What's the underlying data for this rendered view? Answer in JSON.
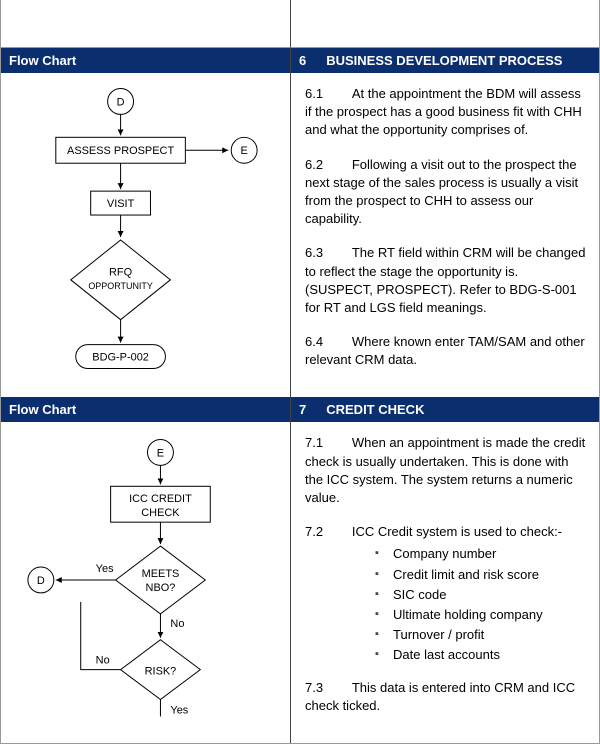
{
  "sections": [
    {
      "left_header": "Flow Chart",
      "right_header_num": "6",
      "right_header_title": "BUSINESS DEVELOPMENT PROCESS",
      "flow": {
        "start": "D",
        "assess": "ASSESS PROSPECT",
        "off_e": "E",
        "visit": "VISIT",
        "rfq1": "RFQ",
        "rfq2": "OPPORTUNITY",
        "bdg": "BDG-P-002"
      },
      "paras": [
        {
          "num": "6.1",
          "text": "At the appointment the BDM will assess if the prospect has a good business fit with CHH and what the opportunity comprises of."
        },
        {
          "num": "6.2",
          "text": "Following a visit out to the prospect the next stage of the sales process is usually a visit from the prospect to CHH to assess our capability."
        },
        {
          "num": "6.3",
          "text": "The RT field within CRM will be changed to reflect the stage the opportunity is. (SUSPECT, PROSPECT). Refer to BDG-S-001 for RT and LGS field meanings."
        },
        {
          "num": "6.4",
          "text": "Where known enter TAM/SAM and other relevant CRM data."
        }
      ]
    },
    {
      "left_header": "Flow Chart",
      "right_header_num": "7",
      "right_header_title": "CREDIT CHECK",
      "flow": {
        "start": "E",
        "icc1": "ICC CREDIT",
        "icc2": "CHECK",
        "meets1": "MEETS",
        "meets2": "NBO?",
        "yes": "Yes",
        "no": "No",
        "d_off": "D",
        "risk": "RISK?",
        "yes2": "Yes",
        "no2": "No"
      },
      "paras": [
        {
          "num": "7.1",
          "text": "When an appointment is made the credit check is usually undertaken.  This is done with the ICC system.  The system returns a numeric value."
        },
        {
          "num": "7.2",
          "text": "ICC Credit system is used to check:-"
        }
      ],
      "bullets": [
        "Company number",
        "Credit limit and risk score",
        "SIC code",
        "Ultimate holding company",
        "Turnover / profit",
        "Date last accounts"
      ],
      "paras_after": [
        {
          "num": "7.3",
          "text": "This data is entered into CRM and ICC check ticked."
        }
      ]
    }
  ]
}
